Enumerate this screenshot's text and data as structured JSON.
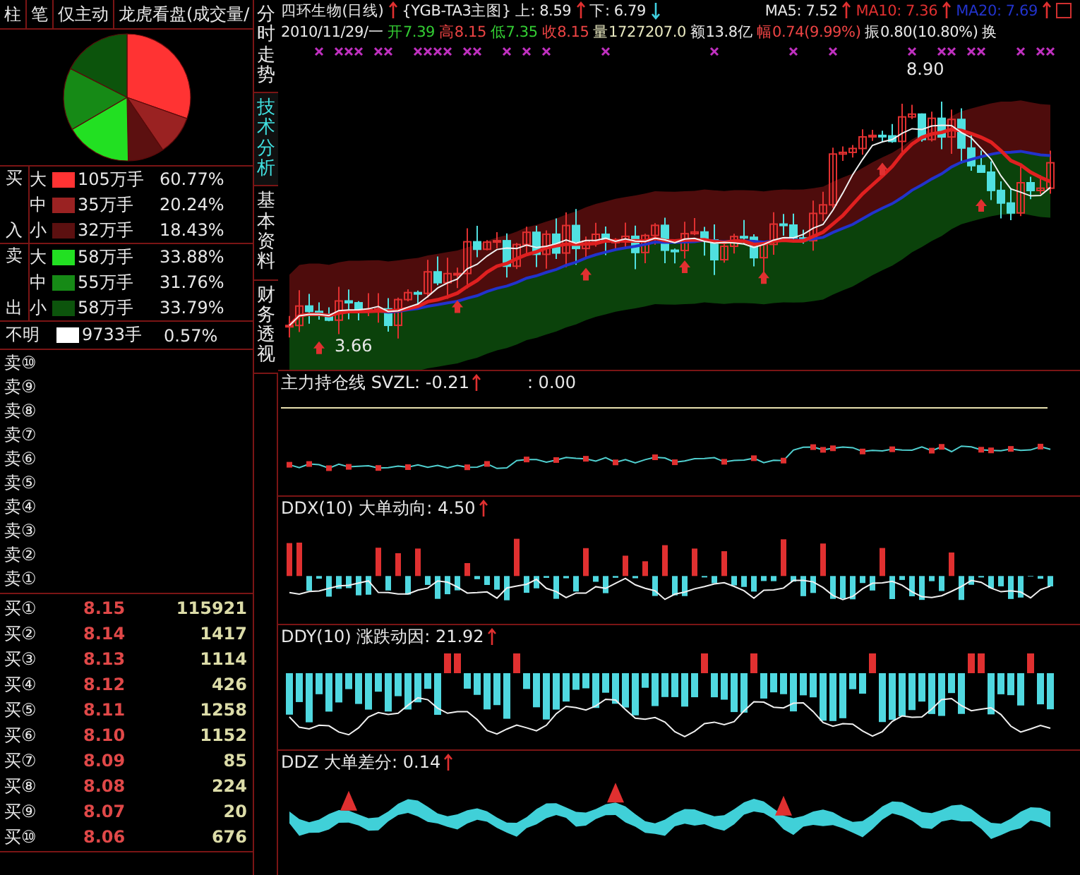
{
  "header_tabs": [
    {
      "label": "柱"
    },
    {
      "label": "笔"
    },
    {
      "label": "仅主动"
    },
    {
      "label": "龙虎看盘(成交量/"
    }
  ],
  "side_tabs": [
    {
      "label": "分时走势",
      "selected": false
    },
    {
      "label": "技术分析",
      "selected": true
    },
    {
      "label": "基本资料",
      "selected": false
    },
    {
      "label": "财务透视",
      "selected": false
    }
  ],
  "flow": {
    "groups": [
      {
        "side_top": "买",
        "side_bottom": "入",
        "rows": [
          {
            "size": "大",
            "color": "#ff3333",
            "volume": "105万手",
            "percent": "60.77%"
          },
          {
            "size": "中",
            "color": "#9a2222",
            "volume": "35万手",
            "percent": "20.24%"
          },
          {
            "size": "小",
            "color": "#5c1010",
            "volume": "32万手",
            "percent": "18.43%"
          }
        ]
      },
      {
        "side_top": "卖",
        "side_bottom": "出",
        "rows": [
          {
            "size": "大",
            "color": "#22e022",
            "volume": "58万手",
            "percent": "33.88%"
          },
          {
            "size": "中",
            "color": "#168a16",
            "volume": "55万手",
            "percent": "31.76%"
          },
          {
            "size": "小",
            "color": "#0c540c",
            "volume": "58万手",
            "percent": "33.79%"
          }
        ]
      }
    ],
    "unknown": {
      "label": "不明",
      "color": "#ffffff",
      "volume": "9733手",
      "percent": "0.57%"
    }
  },
  "ask_levels": [
    {
      "label": "卖⑩"
    },
    {
      "label": "卖⑨"
    },
    {
      "label": "卖⑧"
    },
    {
      "label": "卖⑦"
    },
    {
      "label": "卖⑥"
    },
    {
      "label": "卖⑤"
    },
    {
      "label": "卖④"
    },
    {
      "label": "卖③"
    },
    {
      "label": "卖②"
    },
    {
      "label": "卖①"
    }
  ],
  "bid_levels": [
    {
      "label": "买①",
      "price": "8.15",
      "volume": "115921"
    },
    {
      "label": "买②",
      "price": "8.14",
      "volume": "1417"
    },
    {
      "label": "买③",
      "price": "8.13",
      "volume": "1114"
    },
    {
      "label": "买④",
      "price": "8.12",
      "volume": "426"
    },
    {
      "label": "买⑤",
      "price": "8.11",
      "volume": "1258"
    },
    {
      "label": "买⑥",
      "price": "8.10",
      "volume": "1152"
    },
    {
      "label": "买⑦",
      "price": "8.09",
      "volume": "85"
    },
    {
      "label": "买⑧",
      "price": "8.08",
      "volume": "224"
    },
    {
      "label": "买⑨",
      "price": "8.07",
      "volume": "20"
    },
    {
      "label": "买⑩",
      "price": "8.06",
      "volume": "676"
    }
  ],
  "chart": {
    "title": "四环生物(日线)",
    "indicator": "{YGB-TA3主图}",
    "upper": "上: 8.59",
    "lower": "下: 6.79",
    "ma": [
      {
        "label": "MA5: 7.52",
        "color": "#e8e8e8"
      },
      {
        "label": "MA10: 7.36",
        "color": "#e03030"
      },
      {
        "label": "MA20: 7.69",
        "color": "#2233cc"
      }
    ],
    "quote": [
      {
        "text": "2010/11/29/一",
        "color": "#e8e8e8"
      },
      {
        "text": "开7.39",
        "color": "#33cc33"
      },
      {
        "text": "高8.15",
        "color": "#ee4444"
      },
      {
        "text": "低7.35",
        "color": "#33cc33"
      },
      {
        "text": "收8.15",
        "color": "#ee4444"
      },
      {
        "text": "量1727207.0",
        "color": "#e8e8c0"
      },
      {
        "text": "额13.8亿",
        "color": "#e8e8e8"
      },
      {
        "text": "幅0.74(9.99%)",
        "color": "#ee4444"
      },
      {
        "text": "振0.80(10.80%)",
        "color": "#e8e8e8"
      },
      {
        "text": "换",
        "color": "#e8e8e8"
      }
    ],
    "high_label": "8.90",
    "low_label": "3.66"
  },
  "panels": [
    {
      "kind": "svzl",
      "title": "主力持仓线 SVZL: -0.21",
      "extra": ": 0.00"
    },
    {
      "kind": "ddx",
      "title": "DDX(10) 大单动向: 4.50"
    },
    {
      "kind": "ddy",
      "title": "DDY(10) 涨跌动因: 21.92"
    },
    {
      "kind": "ddz",
      "title": "DDZ 大单差分: 0.14"
    }
  ]
}
